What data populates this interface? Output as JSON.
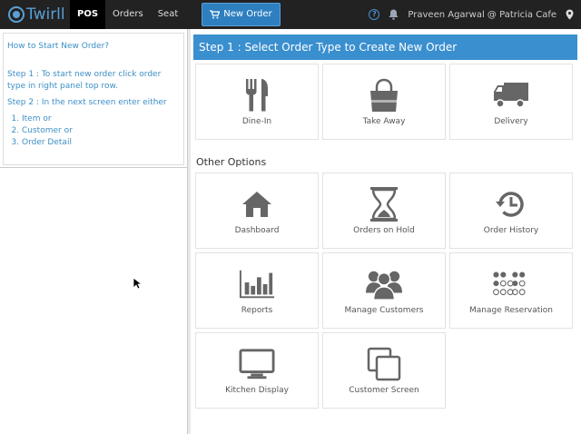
{
  "topbar": {
    "logo_text": "Twirll",
    "tabs": [
      "POS",
      "Orders",
      "Seat"
    ],
    "new_order_label": "New Order",
    "user_text": "Praveen Agarwal @ Patricia Cafe"
  },
  "help": {
    "title": "How to Start New Order?",
    "step1": "Step 1 : To start new order click order type in right panel top row.",
    "step2": "Step 2 : In the next screen enter either",
    "items": [
      "Item or",
      "Customer or",
      "Order Detail"
    ]
  },
  "main": {
    "step_header": "Step 1 : Select Order Type to Create New Order",
    "order_types": [
      {
        "label": "Dine-In",
        "icon": "dine-in-icon"
      },
      {
        "label": "Take Away",
        "icon": "take-away-icon"
      },
      {
        "label": "Delivery",
        "icon": "delivery-truck-icon"
      }
    ],
    "other_options_title": "Other Options",
    "options": [
      {
        "label": "Dashboard",
        "icon": "home-icon"
      },
      {
        "label": "Orders on Hold",
        "icon": "hourglass-icon"
      },
      {
        "label": "Order History",
        "icon": "history-icon"
      },
      {
        "label": "Reports",
        "icon": "bar-chart-icon"
      },
      {
        "label": "Manage Customers",
        "icon": "users-icon"
      },
      {
        "label": "Manage Reservation",
        "icon": "reservation-icon"
      },
      {
        "label": "Kitchen Display",
        "icon": "monitor-icon"
      },
      {
        "label": "Customer Screen",
        "icon": "screens-icon"
      }
    ]
  },
  "colors": {
    "accent": "#3a8fcf",
    "topbar": "#222222",
    "icon_gray": "#666666",
    "help_text": "#3d8fc6"
  }
}
